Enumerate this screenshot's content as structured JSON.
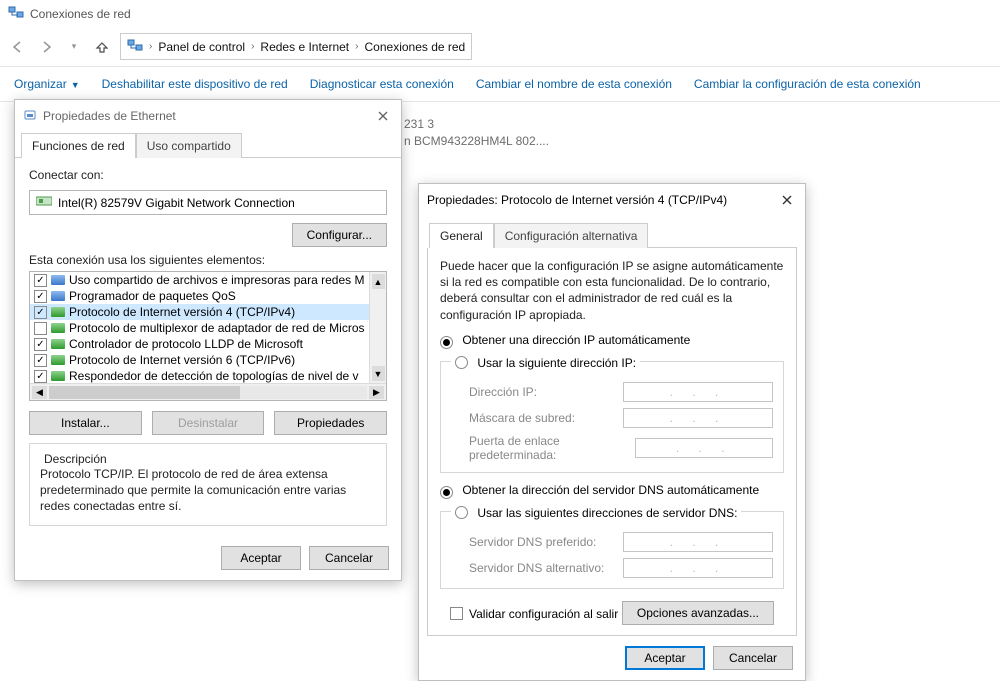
{
  "explorer": {
    "title": "Conexiones de red",
    "breadcrumbs": [
      "Panel de control",
      "Redes e Internet",
      "Conexiones de red"
    ]
  },
  "toolbar": {
    "organize": "Organizar",
    "disable": "Deshabilitar este dispositivo de red",
    "diagnose": "Diagnosticar esta conexión",
    "rename": "Cambiar el nombre de esta conexión",
    "settings": "Cambiar la configuración de esta conexión"
  },
  "bg": {
    "line1": "231 3",
    "line2": "n BCM943228HM4L 802...."
  },
  "dlg1": {
    "title": "Propiedades de Ethernet",
    "tab1": "Funciones de red",
    "tab2": "Uso compartido",
    "connect_label": "Conectar con:",
    "adapter": "Intel(R) 82579V Gigabit Network Connection",
    "configure": "Configurar...",
    "elements_label": "Esta conexión usa los siguientes elementos:",
    "items": [
      {
        "checked": true,
        "icon": "blue",
        "label": "Uso compartido de archivos e impresoras para redes M"
      },
      {
        "checked": true,
        "icon": "blue",
        "label": "Programador de paquetes QoS"
      },
      {
        "checked": true,
        "icon": "green",
        "label": "Protocolo de Internet versión 4 (TCP/IPv4)",
        "selected": true
      },
      {
        "checked": false,
        "icon": "green",
        "label": "Protocolo de multiplexor de adaptador de red de Micros"
      },
      {
        "checked": true,
        "icon": "green",
        "label": "Controlador de protocolo LLDP de Microsoft"
      },
      {
        "checked": true,
        "icon": "green",
        "label": "Protocolo de Internet versión 6 (TCP/IPv6)"
      },
      {
        "checked": true,
        "icon": "green",
        "label": "Respondedor de detección de topologías de nivel de v"
      }
    ],
    "install": "Instalar...",
    "uninstall": "Desinstalar",
    "properties": "Propiedades",
    "desc_title": "Descripción",
    "desc_text": "Protocolo TCP/IP. El protocolo de red de área extensa predeterminado que permite la comunicación entre varias redes conectadas entre sí.",
    "ok": "Aceptar",
    "cancel": "Cancelar"
  },
  "dlg2": {
    "title": "Propiedades: Protocolo de Internet versión 4 (TCP/IPv4)",
    "tab1": "General",
    "tab2": "Configuración alternativa",
    "intro": "Puede hacer que la configuración IP se asigne automáticamente si la red es compatible con esta funcionalidad. De lo contrario, deberá consultar con el administrador de red cuál es la configuración IP apropiada.",
    "auto_ip": "Obtener una dirección IP automáticamente",
    "manual_ip": "Usar la siguiente dirección IP:",
    "ip_addr": "Dirección IP:",
    "subnet": "Máscara de subred:",
    "gateway": "Puerta de enlace predeterminada:",
    "auto_dns": "Obtener la dirección del servidor DNS automáticamente",
    "manual_dns": "Usar las siguientes direcciones de servidor DNS:",
    "dns_pref": "Servidor DNS preferido:",
    "dns_alt": "Servidor DNS alternativo:",
    "validate": "Validar configuración al salir",
    "advanced": "Opciones avanzadas...",
    "ok": "Aceptar",
    "cancel": "Cancelar",
    "dots": ".     .     ."
  }
}
